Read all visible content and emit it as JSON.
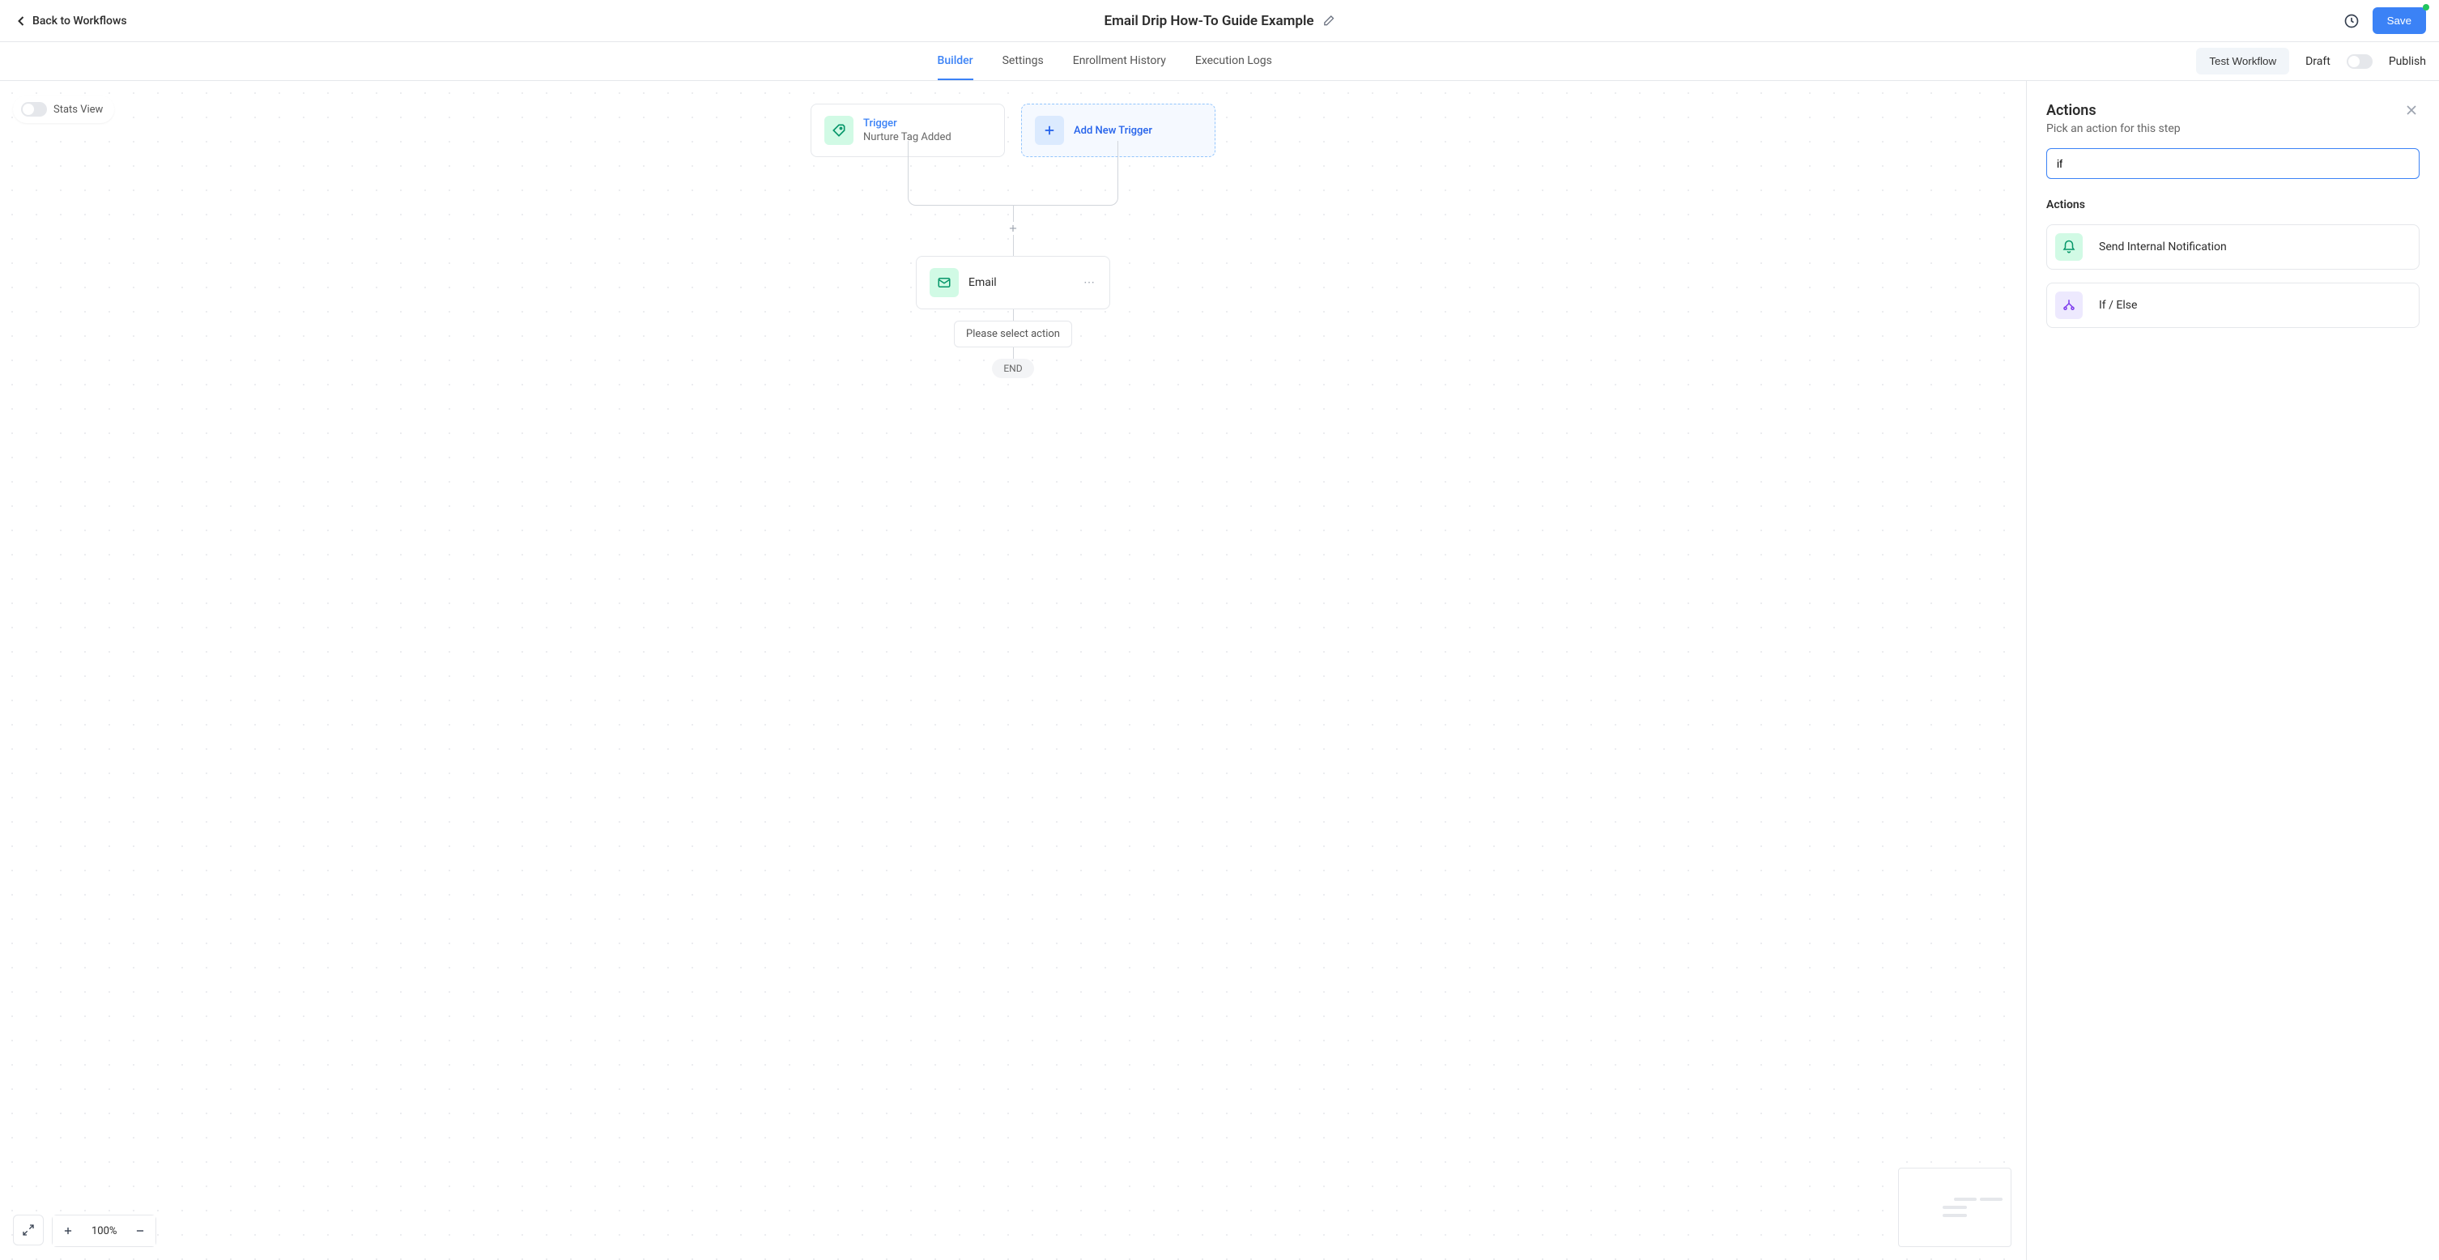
{
  "header": {
    "back": "Back to Workflows",
    "title": "Email Drip How-To Guide Example",
    "save": "Save"
  },
  "tabs": {
    "items": [
      "Builder",
      "Settings",
      "Enrollment History",
      "Execution Logs"
    ],
    "active": 0,
    "test": "Test Workflow",
    "draft": "Draft",
    "publish": "Publish"
  },
  "canvas": {
    "stats_view": "Stats View",
    "trigger_label": "Trigger",
    "trigger_sub": "Nurture Tag Added",
    "add_trigger": "Add New Trigger",
    "email_node": "Email",
    "hint": "Please select action",
    "end": "END",
    "zoom": "100%"
  },
  "panel": {
    "title": "Actions",
    "subtitle": "Pick an action for this step",
    "search_value": "if",
    "section": "Actions",
    "actions": [
      {
        "label": "Send Internal Notification",
        "icon": "bell",
        "color": "green"
      },
      {
        "label": "If / Else",
        "icon": "split",
        "color": "purple"
      }
    ]
  }
}
